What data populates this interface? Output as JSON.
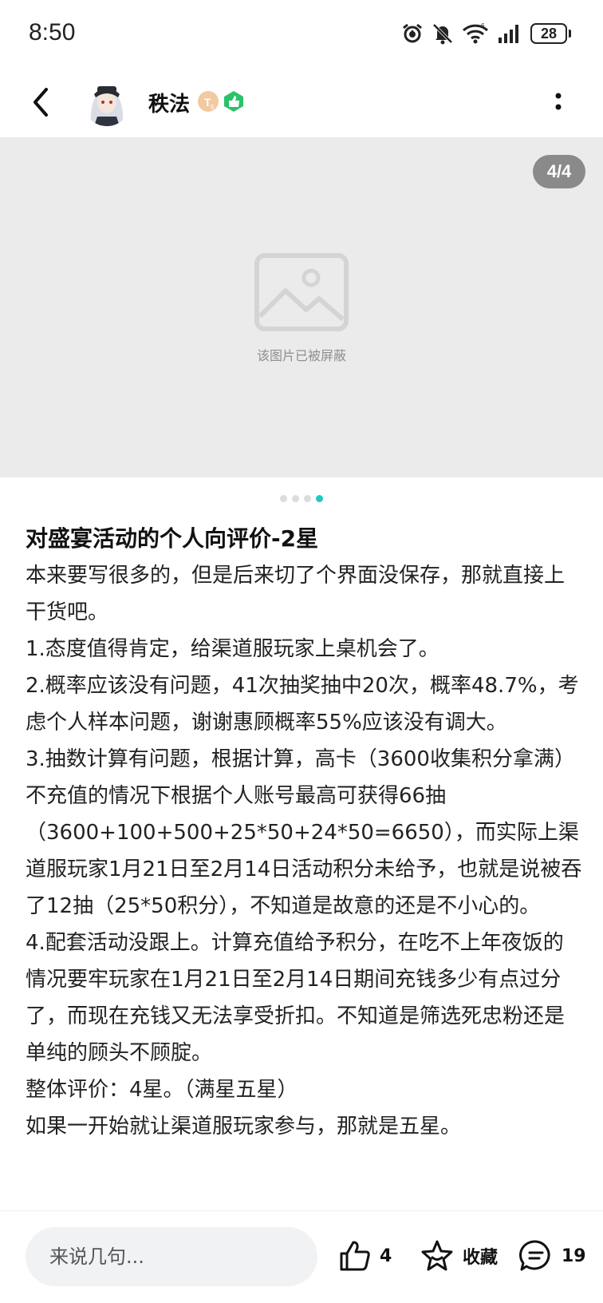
{
  "status_bar": {
    "time": "8:50",
    "battery": "28",
    "icons": [
      "alarm-icon",
      "mute-icon",
      "wifi-icon",
      "signal-icon",
      "battery-icon"
    ]
  },
  "header": {
    "author": "秩法",
    "badges": [
      "level-badge-icon",
      "verified-badge-icon"
    ]
  },
  "image": {
    "counter": "4/4",
    "blocked_text": "该图片已被屏蔽",
    "bg_color": "#ebebeb"
  },
  "carousel": {
    "total": 4,
    "active_index": 4,
    "active_color": "#1fc9c2"
  },
  "post": {
    "title": "对盛宴活动的个人向评价-2星",
    "paragraphs": [
      "本来要写很多的，但是后来切了个界面没保存，那就直接上干货吧。",
      "1.态度值得肯定，给渠道服玩家上桌机会了。",
      "2.概率应该没有问题，41次抽奖抽中20次，概率48.7%，考虑个人样本问题，谢谢惠顾概率55%应该没有调大。",
      "3.抽数计算有问题，根据计算，高卡（3600收集积分拿满）不充值的情况下根据个人账号最高可获得66抽（3600+100+500+25*50+24*50=6650），而实际上渠道服玩家1月21日至2月14日活动积分未给予，也就是说被吞了12抽（25*50积分），不知道是故意的还是不小心的。",
      "4.配套活动没跟上。计算充值给予积分，在吃不上年夜饭的情况要牢玩家在1月21日至2月14日期间充钱多少有点过分了，而现在充钱又无法享受折扣。不知道是筛选死忠粉还是单纯的顾头不顾腚。",
      "整体评价：4星。（满星五星）",
      "如果一开始就让渠道服玩家参与，那就是五星。"
    ]
  },
  "bottom_bar": {
    "comment_placeholder": "来说几句...",
    "like_count": "4",
    "favorite_label": "收藏",
    "comment_count": "19"
  }
}
